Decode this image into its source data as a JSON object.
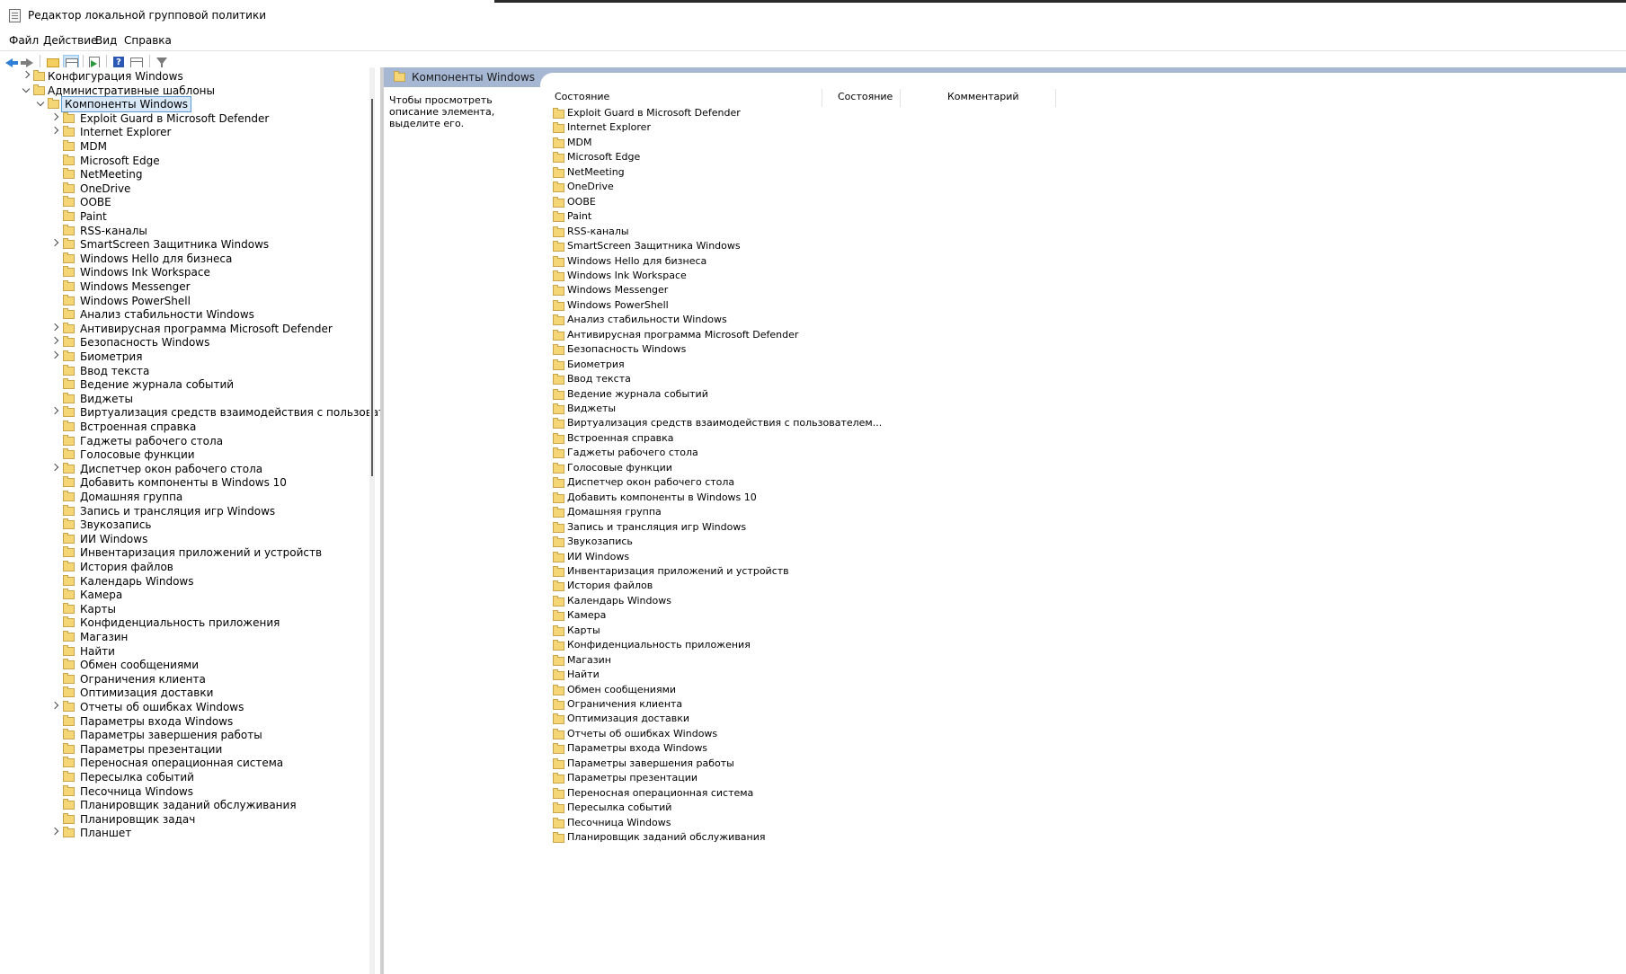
{
  "window": {
    "title": "Редактор локальной групповой политики"
  },
  "menu": [
    "Файл",
    "Действие",
    "Вид",
    "Справка"
  ],
  "tree": {
    "top": [
      {
        "label": "Конфигурация Windows",
        "expander": "right",
        "level": 1
      },
      {
        "label": "Административные шаблоны",
        "expander": "down",
        "level": 1
      },
      {
        "label": "Компоненты Windows",
        "expander": "down",
        "level": 2,
        "selected": true
      }
    ],
    "children": [
      {
        "label": "Exploit Guard в Microsoft Defender",
        "expander": "right"
      },
      {
        "label": "Internet Explorer",
        "expander": "right"
      },
      {
        "label": "MDM",
        "expander": ""
      },
      {
        "label": "Microsoft Edge",
        "expander": ""
      },
      {
        "label": "NetMeeting",
        "expander": ""
      },
      {
        "label": "OneDrive",
        "expander": ""
      },
      {
        "label": "OOBE",
        "expander": ""
      },
      {
        "label": "Paint",
        "expander": ""
      },
      {
        "label": "RSS-каналы",
        "expander": ""
      },
      {
        "label": "SmartScreen Защитника Windows",
        "expander": "right"
      },
      {
        "label": "Windows Hello для бизнеса",
        "expander": ""
      },
      {
        "label": "Windows Ink Workspace",
        "expander": ""
      },
      {
        "label": "Windows Messenger",
        "expander": ""
      },
      {
        "label": "Windows PowerShell",
        "expander": ""
      },
      {
        "label": "Анализ стабильности Windows",
        "expander": ""
      },
      {
        "label": "Антивирусная программа Microsoft Defender",
        "expander": "right"
      },
      {
        "label": "Безопасность Windows",
        "expander": "right"
      },
      {
        "label": "Биометрия",
        "expander": "right"
      },
      {
        "label": "Ввод текста",
        "expander": ""
      },
      {
        "label": "Ведение журнала событий",
        "expander": ""
      },
      {
        "label": "Виджеты",
        "expander": ""
      },
      {
        "label": "Виртуализация средств взаимодействия с пользователем (Майкро",
        "expander": "right"
      },
      {
        "label": "Встроенная справка",
        "expander": ""
      },
      {
        "label": "Гаджеты рабочего стола",
        "expander": ""
      },
      {
        "label": "Голосовые функции",
        "expander": ""
      },
      {
        "label": "Диспетчер окон рабочего стола",
        "expander": "right"
      },
      {
        "label": "Добавить компоненты в Windows 10",
        "expander": ""
      },
      {
        "label": "Домашняя группа",
        "expander": ""
      },
      {
        "label": "Запись и трансляция игр Windows",
        "expander": ""
      },
      {
        "label": "Звукозапись",
        "expander": ""
      },
      {
        "label": "ИИ Windows",
        "expander": ""
      },
      {
        "label": "Инвентаризация приложений и устройств",
        "expander": ""
      },
      {
        "label": "История файлов",
        "expander": ""
      },
      {
        "label": "Календарь Windows",
        "expander": ""
      },
      {
        "label": "Камера",
        "expander": ""
      },
      {
        "label": "Карты",
        "expander": ""
      },
      {
        "label": "Конфиденциальность приложения",
        "expander": ""
      },
      {
        "label": "Магазин",
        "expander": ""
      },
      {
        "label": "Найти",
        "expander": ""
      },
      {
        "label": "Обмен сообщениями",
        "expander": ""
      },
      {
        "label": "Ограничения клиента",
        "expander": ""
      },
      {
        "label": "Оптимизация доставки",
        "expander": ""
      },
      {
        "label": "Отчеты об ошибках Windows",
        "expander": "right"
      },
      {
        "label": "Параметры входа Windows",
        "expander": ""
      },
      {
        "label": "Параметры завершения работы",
        "expander": ""
      },
      {
        "label": "Параметры презентации",
        "expander": ""
      },
      {
        "label": "Переносная операционная система",
        "expander": ""
      },
      {
        "label": "Пересылка событий",
        "expander": ""
      },
      {
        "label": "Песочница Windows",
        "expander": ""
      },
      {
        "label": "Планировщик заданий обслуживания",
        "expander": ""
      },
      {
        "label": "Планировщик задач",
        "expander": ""
      },
      {
        "label": "Планшет",
        "expander": "right"
      }
    ]
  },
  "details": {
    "header_title": "Компоненты Windows",
    "description": "Чтобы просмотреть описание элемента, выделите его.",
    "columns": [
      "Состояние",
      "Состояние",
      "Комментарий"
    ],
    "items": [
      "Exploit Guard в Microsoft Defender",
      "Internet Explorer",
      "MDM",
      "Microsoft Edge",
      "NetMeeting",
      "OneDrive",
      "OOBE",
      "Paint",
      "RSS-каналы",
      "SmartScreen Защитника Windows",
      "Windows Hello для бизнеса",
      "Windows Ink Workspace",
      "Windows Messenger",
      "Windows PowerShell",
      "Анализ стабильности Windows",
      "Антивирусная программа Microsoft Defender",
      "Безопасность Windows",
      "Биометрия",
      "Ввод текста",
      "Ведение журнала событий",
      "Виджеты",
      "Виртуализация средств взаимодействия с пользователем...",
      "Встроенная справка",
      "Гаджеты рабочего стола",
      "Голосовые функции",
      "Диспетчер окон рабочего стола",
      "Добавить компоненты в Windows 10",
      "Домашняя группа",
      "Запись и трансляция игр Windows",
      "Звукозапись",
      "ИИ Windows",
      "Инвентаризация приложений и устройств",
      "История файлов",
      "Календарь Windows",
      "Камера",
      "Карты",
      "Конфиденциальность приложения",
      "Магазин",
      "Найти",
      "Обмен сообщениями",
      "Ограничения клиента",
      "Оптимизация доставки",
      "Отчеты об ошибках Windows",
      "Параметры входа Windows",
      "Параметры завершения работы",
      "Параметры презентации",
      "Переносная операционная система",
      "Пересылка событий",
      "Песочница Windows",
      "Планировщик заданий обслуживания"
    ]
  },
  "colors": {
    "header_band": "#a5b7d3",
    "folder": "#f5d677",
    "selection": "#d9e8f7"
  },
  "icons": [
    "app-icon",
    "back-icon",
    "forward-icon",
    "up-folder-icon",
    "show-hide-tree-icon",
    "export-list-icon",
    "help-icon",
    "properties-icon",
    "filter-icon",
    "folder-icon",
    "chevron-right-icon",
    "chevron-down-icon"
  ]
}
